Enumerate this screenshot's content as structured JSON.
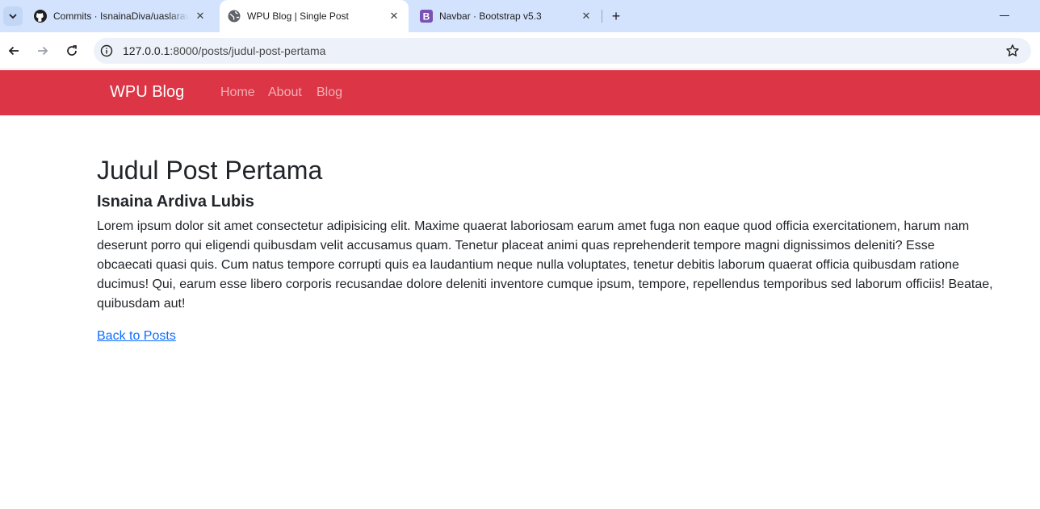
{
  "browser": {
    "tabs": [
      {
        "title": "Commits · IsnainaDiva/uaslaravel",
        "favicon": "github-icon",
        "active": false
      },
      {
        "title": "WPU Blog | Single Post",
        "favicon": "globe-icon",
        "active": true
      },
      {
        "title": "Navbar · Bootstrap v5.3",
        "favicon": "bootstrap-icon",
        "active": false
      }
    ],
    "address": {
      "host": "127.0.0.1",
      "path": ":8000/posts/judul-post-pertama"
    }
  },
  "navbar": {
    "brand": "WPU Blog",
    "links": [
      "Home",
      "About",
      "Blog"
    ],
    "background": "#dc3545"
  },
  "post": {
    "title": "Judul Post Pertama",
    "author": "Isnaina Ardiva Lubis",
    "body": "Lorem ipsum dolor sit amet consectetur adipisicing elit. Maxime quaerat laboriosam earum amet fuga non eaque quod officia exercitationem, harum nam deserunt porro qui eligendi quibusdam velit accusamus quam. Tenetur placeat animi quas reprehenderit tempore magni dignissimos deleniti? Esse obcaecati quasi quis. Cum natus tempore corrupti quis ea laudantium neque nulla voluptates, tenetur debitis laborum quaerat officia quibusdam ratione ducimus! Qui, earum esse libero corporis recusandae dolore deleniti inventore cumque ipsum, tempore, repellendus temporibus sed laborum officiis! Beatae, quibusdam aut!",
    "back_link": "Back to Posts"
  }
}
